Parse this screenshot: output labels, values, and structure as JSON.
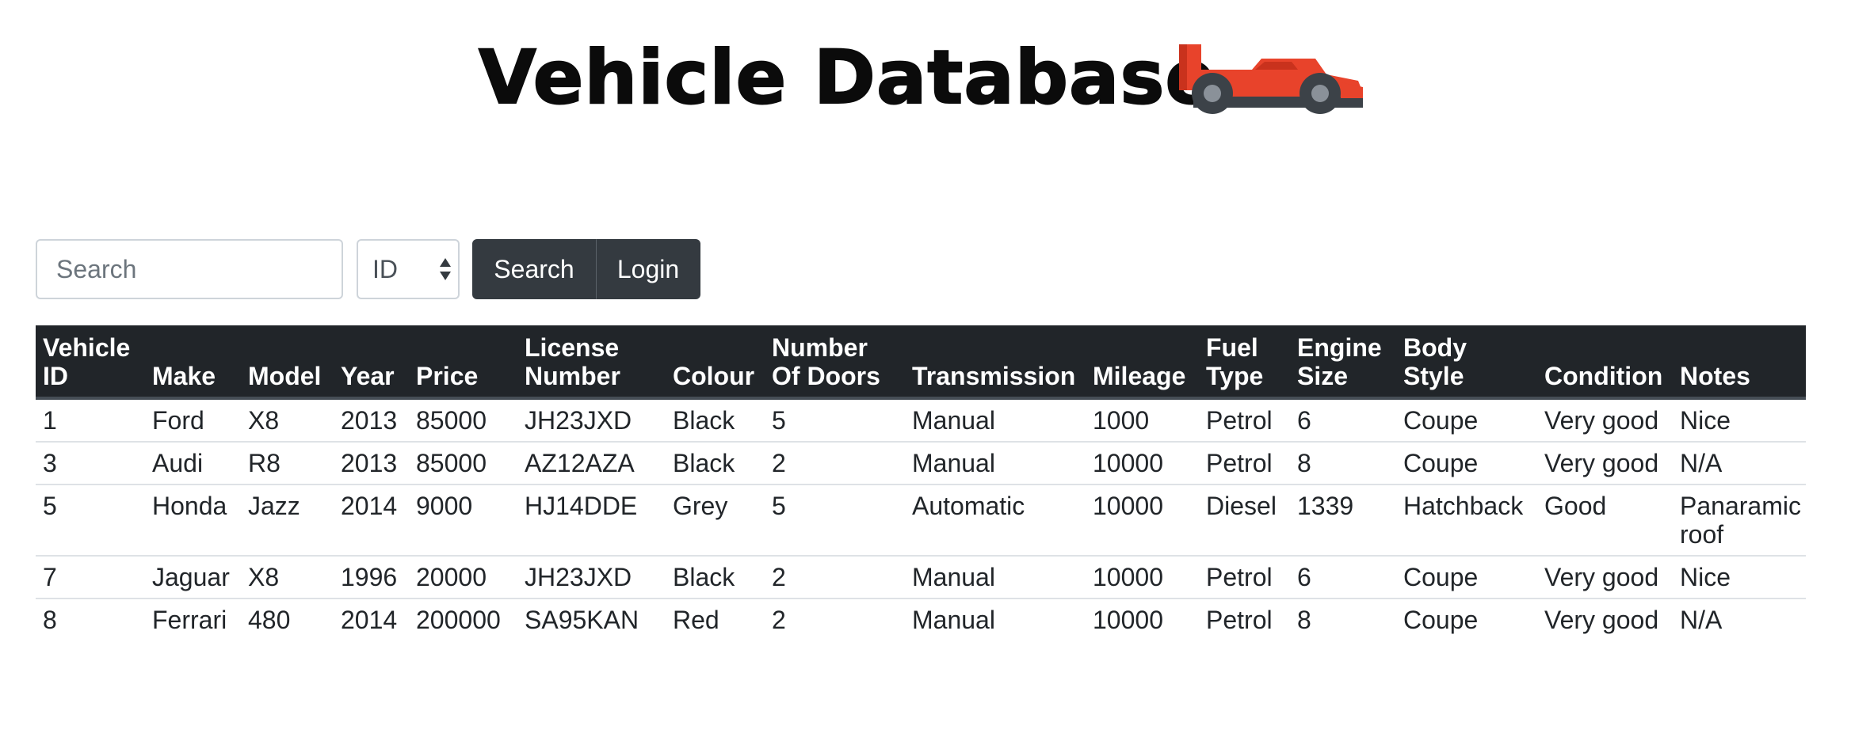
{
  "header": {
    "title": "Vehicle Database",
    "logo_icon": "race-car-icon"
  },
  "search": {
    "placeholder": "Search",
    "value": "",
    "filter_selected": "ID",
    "search_button": "Search",
    "login_button": "Login"
  },
  "colors": {
    "table_header_bg": "#212529",
    "button_bg": "#343a40",
    "car_body": "#e8432b",
    "car_wheels": "#3c4248"
  },
  "table": {
    "columns": [
      "Vehicle ID",
      "Make",
      "Model",
      "Year",
      "Price",
      "License Number",
      "Colour",
      "Number Of Doors",
      "Transmission",
      "Mileage",
      "Fuel Type",
      "Engine Size",
      "Body Style",
      "Condition",
      "Notes"
    ],
    "rows": [
      [
        "1",
        "Ford",
        "X8",
        "2013",
        "85000",
        "JH23JXD",
        "Black",
        "5",
        "Manual",
        "1000",
        "Petrol",
        "6",
        "Coupe",
        "Very good",
        "Nice"
      ],
      [
        "3",
        "Audi",
        "R8",
        "2013",
        "85000",
        "AZ12AZA",
        "Black",
        "2",
        "Manual",
        "10000",
        "Petrol",
        "8",
        "Coupe",
        "Very good",
        "N/A"
      ],
      [
        "5",
        "Honda",
        "Jazz",
        "2014",
        "9000",
        "HJ14DDE",
        "Grey",
        "5",
        "Automatic",
        "10000",
        "Diesel",
        "1339",
        "Hatchback",
        "Good",
        "Panaramic roof"
      ],
      [
        "7",
        "Jaguar",
        "X8",
        "1996",
        "20000",
        "JH23JXD",
        "Black",
        "2",
        "Manual",
        "10000",
        "Petrol",
        "6",
        "Coupe",
        "Very good",
        "Nice"
      ],
      [
        "8",
        "Ferrari",
        "480",
        "2014",
        "200000",
        "SA95KAN",
        "Red",
        "2",
        "Manual",
        "10000",
        "Petrol",
        "8",
        "Coupe",
        "Very good",
        "N/A"
      ]
    ]
  }
}
